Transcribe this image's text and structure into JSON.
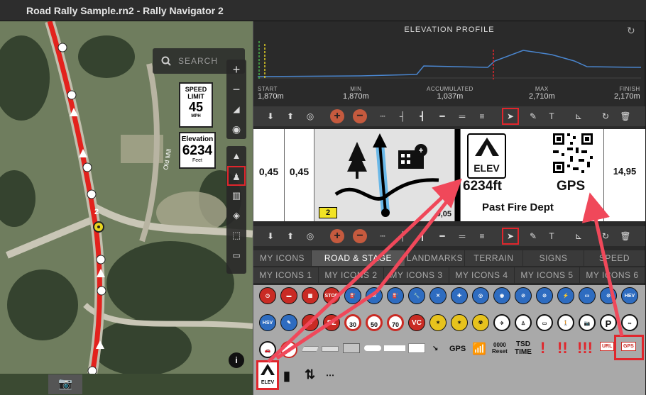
{
  "window": {
    "title": "Road Rally Sample.rn2 - Rally Navigator 2"
  },
  "map": {
    "search_placeholder": "SEARCH",
    "speed_sign": {
      "title": "SPEED LIMIT",
      "value": "45",
      "unit": "MPH"
    },
    "elevation_sign": {
      "title": "Elevation",
      "value": "6234",
      "unit": "Feet"
    },
    "waypoint_label": "2",
    "road_label": "Old Mill"
  },
  "elevation_profile": {
    "title": "ELEVATION PROFILE",
    "stats": [
      {
        "label": "START",
        "value": "1,870m"
      },
      {
        "label": "MIN",
        "value": "1,870m"
      },
      {
        "label": "ACCUMULATED",
        "value": "1,037m"
      },
      {
        "label": "MAX",
        "value": "2,710m"
      },
      {
        "label": "FINISH",
        "value": "2,170m"
      }
    ]
  },
  "roadbook": {
    "dist_total": "0,45",
    "dist_partial": "0,45",
    "box_number": "2",
    "box_dist": "9,05",
    "elev_icon_label": "ELEV",
    "elev_text": "6234ft",
    "gps_text": "GPS",
    "note": "Past Fire Dept",
    "next_dist": "14,95"
  },
  "tabs_row1": [
    "MY ICONS",
    "ROAD & STAGE RALLY",
    "LANDMARKS",
    "TERRAIN",
    "SIGNS",
    "SPEED"
  ],
  "tabs_row2": [
    "MY ICONS 1",
    "MY ICONS 2",
    "MY ICONS 3",
    "MY ICONS 4",
    "MY ICONS 5",
    "MY ICONS 6"
  ],
  "icon_labels": {
    "stop": "STOP",
    "hev": "HEV",
    "hsv": "HSV",
    "sz": "SZ",
    "s30": "30",
    "s50": "50",
    "s70": "70",
    "vc": "VC",
    "gps": "GPS",
    "reset_num": "0000",
    "reset": "Reset",
    "tsd": "TSD",
    "time": "TIME",
    "p": "P",
    "url": "URL",
    "gps_small": "GPS",
    "elev_small": "ELEV"
  },
  "colors": {
    "accent": "#e0262c",
    "route": "#e3221d",
    "panel": "#2a2a2a"
  }
}
